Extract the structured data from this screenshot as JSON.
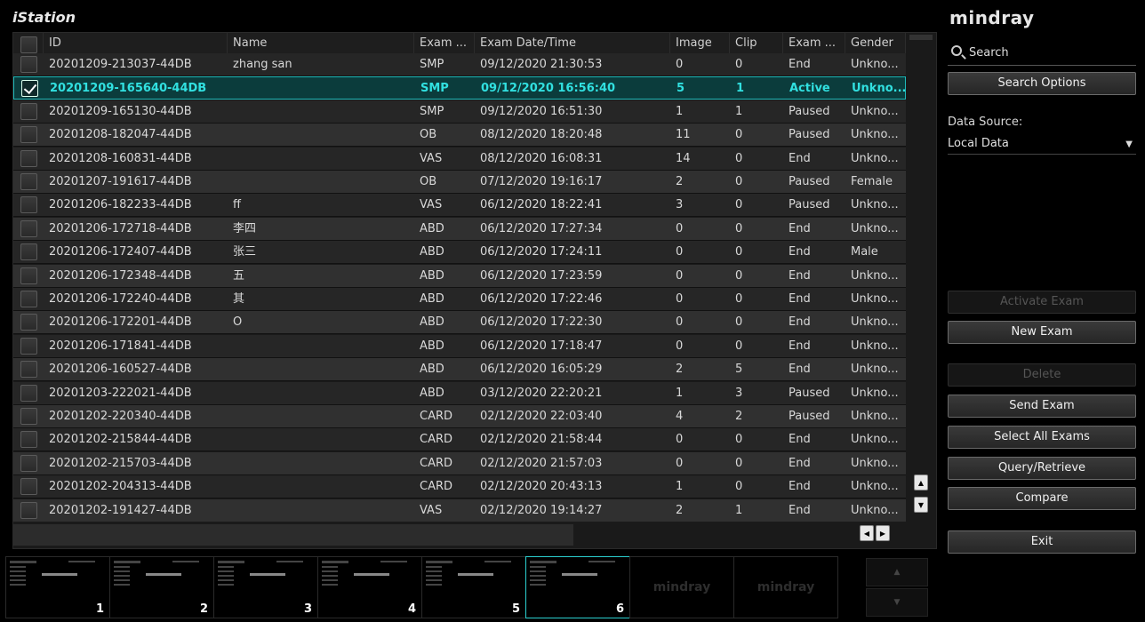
{
  "app": {
    "title": "iStation",
    "brand": "mindray"
  },
  "table": {
    "columns": [
      "ID",
      "Name",
      "Exam ...",
      "Exam Date/Time",
      "Image",
      "Clip",
      "Exam ...",
      "Gender"
    ],
    "rows": [
      {
        "id": "20201209-213037-44DB",
        "name": "zhang san",
        "exam": "SMP",
        "datetime": "09/12/2020 21:30:53",
        "image": "0",
        "clip": "0",
        "status": "End",
        "gender": "Unkno...",
        "checked": false
      },
      {
        "id": "20201209-165640-44DB",
        "name": "",
        "exam": "SMP",
        "datetime": "09/12/2020 16:56:40",
        "image": "5",
        "clip": "1",
        "status": "Active",
        "gender": "Unkno...",
        "checked": true
      },
      {
        "id": "20201209-165130-44DB",
        "name": "",
        "exam": "SMP",
        "datetime": "09/12/2020 16:51:30",
        "image": "1",
        "clip": "1",
        "status": "Paused",
        "gender": "Unkno...",
        "checked": false
      },
      {
        "id": "20201208-182047-44DB",
        "name": "",
        "exam": "OB",
        "datetime": "08/12/2020 18:20:48",
        "image": "11",
        "clip": "0",
        "status": "Paused",
        "gender": "Unkno...",
        "checked": false
      },
      {
        "id": "20201208-160831-44DB",
        "name": "",
        "exam": "VAS",
        "datetime": "08/12/2020 16:08:31",
        "image": "14",
        "clip": "0",
        "status": "End",
        "gender": "Unkno...",
        "checked": false
      },
      {
        "id": "20201207-191617-44DB",
        "name": "",
        "exam": "OB",
        "datetime": "07/12/2020 19:16:17",
        "image": "2",
        "clip": "0",
        "status": "Paused",
        "gender": "Female",
        "checked": false
      },
      {
        "id": "20201206-182233-44DB",
        "name": "ff",
        "exam": "VAS",
        "datetime": "06/12/2020 18:22:41",
        "image": "3",
        "clip": "0",
        "status": "Paused",
        "gender": "Unkno...",
        "checked": false
      },
      {
        "id": "20201206-172718-44DB",
        "name": "李四",
        "exam": "ABD",
        "datetime": "06/12/2020 17:27:34",
        "image": "0",
        "clip": "0",
        "status": "End",
        "gender": "Unkno...",
        "checked": false
      },
      {
        "id": "20201206-172407-44DB",
        "name": "张三",
        "exam": "ABD",
        "datetime": "06/12/2020 17:24:11",
        "image": "0",
        "clip": "0",
        "status": "End",
        "gender": "Male",
        "checked": false
      },
      {
        "id": "20201206-172348-44DB",
        "name": "五",
        "exam": "ABD",
        "datetime": "06/12/2020 17:23:59",
        "image": "0",
        "clip": "0",
        "status": "End",
        "gender": "Unkno...",
        "checked": false
      },
      {
        "id": "20201206-172240-44DB",
        "name": "其",
        "exam": "ABD",
        "datetime": "06/12/2020 17:22:46",
        "image": "0",
        "clip": "0",
        "status": "End",
        "gender": "Unkno...",
        "checked": false
      },
      {
        "id": "20201206-172201-44DB",
        "name": "O",
        "exam": "ABD",
        "datetime": "06/12/2020 17:22:30",
        "image": "0",
        "clip": "0",
        "status": "End",
        "gender": "Unkno...",
        "checked": false
      },
      {
        "id": "20201206-171841-44DB",
        "name": "",
        "exam": "ABD",
        "datetime": "06/12/2020 17:18:47",
        "image": "0",
        "clip": "0",
        "status": "End",
        "gender": "Unkno...",
        "checked": false
      },
      {
        "id": "20201206-160527-44DB",
        "name": "",
        "exam": "ABD",
        "datetime": "06/12/2020 16:05:29",
        "image": "2",
        "clip": "5",
        "status": "End",
        "gender": "Unkno...",
        "checked": false
      },
      {
        "id": "20201203-222021-44DB",
        "name": "",
        "exam": "ABD",
        "datetime": "03/12/2020 22:20:21",
        "image": "1",
        "clip": "3",
        "status": "Paused",
        "gender": "Unkno...",
        "checked": false
      },
      {
        "id": "20201202-220340-44DB",
        "name": "",
        "exam": "CARD",
        "datetime": "02/12/2020 22:03:40",
        "image": "4",
        "clip": "2",
        "status": "Paused",
        "gender": "Unkno...",
        "checked": false
      },
      {
        "id": "20201202-215844-44DB",
        "name": "",
        "exam": "CARD",
        "datetime": "02/12/2020 21:58:44",
        "image": "0",
        "clip": "0",
        "status": "End",
        "gender": "Unkno...",
        "checked": false
      },
      {
        "id": "20201202-215703-44DB",
        "name": "",
        "exam": "CARD",
        "datetime": "02/12/2020 21:57:03",
        "image": "0",
        "clip": "0",
        "status": "End",
        "gender": "Unkno...",
        "checked": false
      },
      {
        "id": "20201202-204313-44DB",
        "name": "",
        "exam": "CARD",
        "datetime": "02/12/2020 20:43:13",
        "image": "1",
        "clip": "0",
        "status": "End",
        "gender": "Unkno...",
        "checked": false
      },
      {
        "id": "20201202-191427-44DB",
        "name": "",
        "exam": "VAS",
        "datetime": "02/12/2020 19:14:27",
        "image": "2",
        "clip": "1",
        "status": "End",
        "gender": "Unkno...",
        "checked": false
      }
    ]
  },
  "panel": {
    "search_placeholder": "Search",
    "search_options": "Search Options",
    "data_source_label": "Data Source:",
    "data_source_value": "Local Data",
    "activate_exam": "Activate Exam",
    "new_exam": "New Exam",
    "delete": "Delete",
    "send_exam": "Send Exam",
    "select_all": "Select All Exams",
    "query_retrieve": "Query/Retrieve",
    "compare": "Compare",
    "exit": "Exit"
  },
  "thumbnails": [
    {
      "num": "1"
    },
    {
      "num": "2"
    },
    {
      "num": "3"
    },
    {
      "num": "4"
    },
    {
      "num": "5"
    },
    {
      "num": "6"
    },
    {
      "watermark": "mindray"
    },
    {
      "watermark": "mindray"
    }
  ],
  "icons": {
    "scroll_up": "▲",
    "scroll_down": "▼",
    "scroll_left": "◀",
    "scroll_right": "▶",
    "dropdown": "▼",
    "thumb_up": "▲",
    "thumb_down": "▼"
  },
  "colors": {
    "accent": "#1fb8b8",
    "selected_text": "#31e0e0",
    "selected_row": "#0b3c3c"
  }
}
